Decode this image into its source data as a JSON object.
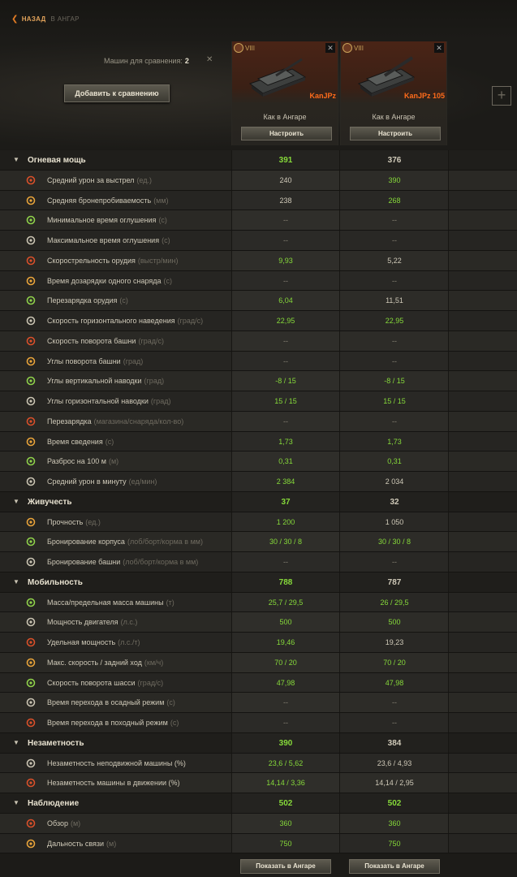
{
  "nav": {
    "back_label": "НАЗАД",
    "back_to": "В АНГАР"
  },
  "header": {
    "count_label": "Машин для сравнения:",
    "count_value": "2",
    "add_button": "Добавить к сравнению"
  },
  "vehicles": [
    {
      "tier": "VIII",
      "name": "KanJPz",
      "config": "Как в Ангаре",
      "setup_button": "Настроить",
      "hangar_button": "Показать в Ангаре"
    },
    {
      "tier": "VIII",
      "name": "KanJPz 105",
      "config": "Как в Ангаре",
      "setup_button": "Настроить",
      "hangar_button": "Показать в Ангаре"
    }
  ],
  "colors": {
    "accent": "#e07b24",
    "tank_name": "#ff6b1a",
    "better": "#86d93a"
  },
  "sections": [
    {
      "name": "Огневая мощь",
      "v1": "391",
      "v2": "376",
      "c1": "g",
      "c2": "n",
      "stats": [
        {
          "icon": "shell-icon",
          "label": "Средний урон за выстрел",
          "unit": "(ед.)",
          "v1": "240",
          "v2": "390",
          "c1": "n",
          "c2": "g"
        },
        {
          "icon": "penetration-icon",
          "label": "Средняя бронепробиваемость",
          "unit": "(мм)",
          "v1": "238",
          "v2": "268",
          "c1": "n",
          "c2": "g"
        },
        {
          "icon": "stun-min-icon",
          "label": "Минимальное время оглушения",
          "unit": "(с)",
          "v1": "--",
          "v2": "--",
          "c1": "d",
          "c2": "d"
        },
        {
          "icon": "stun-max-icon",
          "label": "Максимальное время оглушения",
          "unit": "(с)",
          "v1": "--",
          "v2": "--",
          "c1": "d",
          "c2": "d"
        },
        {
          "icon": "rate-of-fire-icon",
          "label": "Скорострельность орудия",
          "unit": "(выстр/мин)",
          "v1": "9,93",
          "v2": "5,22",
          "c1": "g",
          "c2": "n"
        },
        {
          "icon": "autoreload-icon",
          "label": "Время дозарядки одного снаряда",
          "unit": "(с)",
          "v1": "--",
          "v2": "--",
          "c1": "d",
          "c2": "d"
        },
        {
          "icon": "reload-icon",
          "label": "Перезарядка орудия",
          "unit": "(с)",
          "v1": "6,04",
          "v2": "11,51",
          "c1": "g",
          "c2": "n"
        },
        {
          "icon": "traverse-icon",
          "label": "Скорость горизонтального наведения",
          "unit": "(град/с)",
          "v1": "22,95",
          "v2": "22,95",
          "c1": "g",
          "c2": "g"
        },
        {
          "icon": "turret-speed-icon",
          "label": "Скорость поворота башни",
          "unit": "(град/с)",
          "v1": "--",
          "v2": "--",
          "c1": "d",
          "c2": "d"
        },
        {
          "icon": "turret-arc-icon",
          "label": "Углы поворота башни",
          "unit": "(град)",
          "v1": "--",
          "v2": "--",
          "c1": "d",
          "c2": "d"
        },
        {
          "icon": "elevation-icon",
          "label": "Углы вертикальной наводки",
          "unit": "(град)",
          "v1": "-8 / 15",
          "v2": "-8 / 15",
          "c1": "g",
          "c2": "g"
        },
        {
          "icon": "horizontal-arc-icon",
          "label": "Углы горизонтальной наводки",
          "unit": "(град)",
          "v1": "15 / 15",
          "v2": "15 / 15",
          "c1": "g",
          "c2": "g"
        },
        {
          "icon": "magazine-icon",
          "label": "Перезарядка",
          "unit": "(магазина/снаряда/кол-во)",
          "v1": "--",
          "v2": "--",
          "c1": "d",
          "c2": "d"
        },
        {
          "icon": "aim-time-icon",
          "label": "Время сведения",
          "unit": "(с)",
          "v1": "1,73",
          "v2": "1,73",
          "c1": "g",
          "c2": "g"
        },
        {
          "icon": "dispersion-icon",
          "label": "Разброс на 100 м",
          "unit": "(м)",
          "v1": "0,31",
          "v2": "0,31",
          "c1": "g",
          "c2": "g"
        },
        {
          "icon": "dpm-icon",
          "label": "Средний урон в минуту",
          "unit": "(ед/мин)",
          "v1": "2 384",
          "v2": "2 034",
          "c1": "g",
          "c2": "n"
        }
      ]
    },
    {
      "name": "Живучесть",
      "v1": "37",
      "v2": "32",
      "c1": "g",
      "c2": "n",
      "stats": [
        {
          "icon": "hitpoints-icon",
          "label": "Прочность",
          "unit": "(ед.)",
          "v1": "1 200",
          "v2": "1 050",
          "c1": "g",
          "c2": "n"
        },
        {
          "icon": "hull-armor-icon",
          "label": "Бронирование корпуса",
          "unit": "(лоб/борт/корма в мм)",
          "v1": "30 / 30 / 8",
          "v2": "30 / 30 / 8",
          "c1": "g",
          "c2": "g"
        },
        {
          "icon": "turret-armor-icon",
          "label": "Бронирование башни",
          "unit": "(лоб/борт/корма в мм)",
          "v1": "--",
          "v2": "--",
          "c1": "d",
          "c2": "d"
        }
      ]
    },
    {
      "name": "Мобильность",
      "v1": "788",
      "v2": "787",
      "c1": "g",
      "c2": "n",
      "stats": [
        {
          "icon": "weight-icon",
          "label": "Масса/предельная масса машины",
          "unit": "(т)",
          "v1": "25,7 / 29,5",
          "v2": "26 / 29,5",
          "c1": "g",
          "c2": "g"
        },
        {
          "icon": "engine-icon",
          "label": "Мощность двигателя",
          "unit": "(л.с.)",
          "v1": "500",
          "v2": "500",
          "c1": "g",
          "c2": "g"
        },
        {
          "icon": "power-ratio-icon",
          "label": "Удельная мощность",
          "unit": "(л.с./т)",
          "v1": "19,46",
          "v2": "19,23",
          "c1": "g",
          "c2": "n"
        },
        {
          "icon": "speed-icon",
          "label": "Макс. скорость / задний ход",
          "unit": "(км/ч)",
          "v1": "70 / 20",
          "v2": "70 / 20",
          "c1": "g",
          "c2": "g"
        },
        {
          "icon": "hull-traverse-icon",
          "label": "Скорость поворота шасси",
          "unit": "(град/с)",
          "v1": "47,98",
          "v2": "47,98",
          "c1": "g",
          "c2": "g"
        },
        {
          "icon": "siege-mode-icon",
          "label": "Время перехода в осадный режим",
          "unit": "(с)",
          "v1": "--",
          "v2": "--",
          "c1": "d",
          "c2": "d"
        },
        {
          "icon": "travel-mode-icon",
          "label": "Время перехода в походный режим",
          "unit": "(с)",
          "v1": "--",
          "v2": "--",
          "c1": "d",
          "c2": "d"
        }
      ]
    },
    {
      "name": "Незаметность",
      "v1": "390",
      "v2": "384",
      "c1": "g",
      "c2": "n",
      "stats": [
        {
          "icon": "camo-stationary-icon",
          "label": "Незаметность неподвижной машины (%)",
          "unit": "",
          "v1": "23,6 / 5,62",
          "v2": "23,6 / 4,93",
          "c1": "g",
          "c2": "n"
        },
        {
          "icon": "camo-moving-icon",
          "label": "Незаметность машины в движении (%)",
          "unit": "",
          "v1": "14,14 / 3,36",
          "v2": "14,14 / 2,95",
          "c1": "g",
          "c2": "n"
        }
      ]
    },
    {
      "name": "Наблюдение",
      "v1": "502",
      "v2": "502",
      "c1": "g",
      "c2": "g",
      "stats": [
        {
          "icon": "view-range-icon",
          "label": "Обзор",
          "unit": "(м)",
          "v1": "360",
          "v2": "360",
          "c1": "g",
          "c2": "g"
        },
        {
          "icon": "radio-range-icon",
          "label": "Дальность связи",
          "unit": "(м)",
          "v1": "750",
          "v2": "750",
          "c1": "g",
          "c2": "g"
        }
      ]
    }
  ]
}
